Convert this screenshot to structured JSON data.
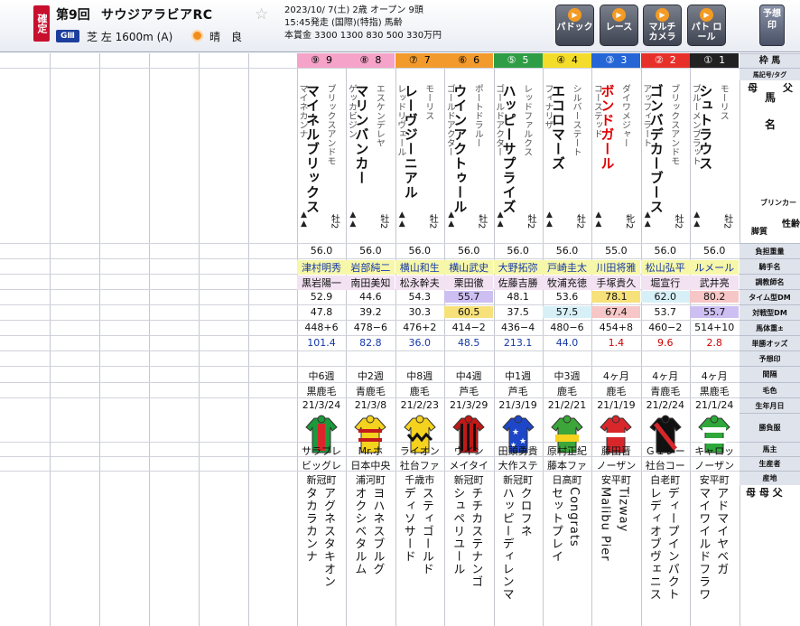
{
  "header": {
    "kakutei": "確定",
    "race_no": "第9回",
    "race_name": "サウジアラビアRC",
    "grade": "GⅢ",
    "course": "芝 左 1600m (A)",
    "weather": "晴",
    "track": "良",
    "info1": "2023/10/ 7(土) 2歳 オープン 9頭",
    "info2": "15:45発走 (国際)(特指) 馬齢",
    "info3": "本賞金 3300 1300 830 500 330万円",
    "buttons": [
      {
        "label": "パドック"
      },
      {
        "label": "レース"
      },
      {
        "label": "マルチ カメラ"
      },
      {
        "label": "パト ロール"
      }
    ],
    "yoso": "予想印"
  },
  "labels": {
    "waku_uma": "枠 馬",
    "kigo": "馬記号/タグ",
    "haha": "母",
    "uma": "馬",
    "chichi": "父",
    "mei": "名",
    "blinker": "ブリンカー",
    "kyakushitsu": "脚質",
    "seirei": "性齢",
    "futan": "負担重量",
    "kishu": "騎手名",
    "chokyo": "調教師名",
    "time_dm": "タイム型DM",
    "taisen_dm": "対戦型DM",
    "bataiju": "馬体重±",
    "odds": "単勝オッズ",
    "yosou": "予想印",
    "kankaku": "間隔",
    "keiro": "毛色",
    "seinen": "生年月日",
    "fuku": "勝負服",
    "banushi": "馬主",
    "seisansha": "生産者",
    "sanchi": "産地",
    "hahachichi": "母 母 父"
  },
  "horses": [
    {
      "waku": "①",
      "num": "1",
      "name": "シュトラウス",
      "sire": "モーリス",
      "dam": "ブルーメンブラット",
      "sex": "牡2",
      "weight": "56.0",
      "jockey": "ルメール",
      "trainer": "武井亮",
      "tdm": "80.2",
      "ddm": "55.7",
      "body": "514+10",
      "odds": "2.8",
      "interval": "4ヶ月",
      "coat": "黒鹿毛",
      "born": "21/1/24",
      "owner": "キャロッ",
      "breeder": "ノーザン",
      "region": "安平町",
      "damsire": "アドマイヤベガ",
      "damdam": "マイワイルドフラワ",
      "silk": "green"
    },
    {
      "waku": "②",
      "num": "2",
      "name": "ゴンバデカーブース",
      "sire": "ブリックスアンドモ",
      "dam": "アッフィラート",
      "sex": "牡2",
      "weight": "56.0",
      "jockey": "松山弘平",
      "trainer": "堀宣行",
      "tdm": "62.0",
      "ddm": "53.7",
      "body": "460−2",
      "odds": "9.6",
      "interval": "4ヶ月",
      "coat": "青鹿毛",
      "born": "21/2/24",
      "owner": "Ｇ１レー",
      "breeder": "社台コー",
      "region": "白老町",
      "damsire": "ディープインパクト",
      "damdam": "レディオブヴェニス",
      "silk": "black"
    },
    {
      "waku": "③",
      "num": "3",
      "name": "ボンドガール",
      "sire": "ダイワメジャー",
      "dam": "コーステッド",
      "sex": "牝2",
      "weight": "55.0",
      "jockey": "川田将雅",
      "trainer": "手塚貴久",
      "tdm": "78.1",
      "ddm": "67.4",
      "body": "454+8",
      "odds": "1.4",
      "interval": "4ヶ月",
      "coat": "鹿毛",
      "born": "21/1/19",
      "owner": "藤田晋",
      "breeder": "ノーザン",
      "region": "安平町",
      "damsire": "Tizway",
      "damdam": "Malibu Pier",
      "silk": "red"
    },
    {
      "waku": "④",
      "num": "4",
      "name": "エコロマーズ",
      "sire": "シルバーステート",
      "dam": "フィナリザ",
      "sex": "牡2",
      "weight": "56.0",
      "jockey": "戸崎圭太",
      "trainer": "牧浦充徳",
      "tdm": "53.6",
      "ddm": "57.5",
      "body": "480−6",
      "odds": "44.0",
      "interval": "中3週",
      "coat": "鹿毛",
      "born": "21/2/21",
      "owner": "原村正紀",
      "breeder": "藤本ファ",
      "region": "日高町",
      "damsire": "Congrats",
      "damdam": "セットプレイ",
      "silk": "lime"
    },
    {
      "waku": "⑤",
      "num": "5",
      "name": "ハッピーサプライズ",
      "sire": "レッドファルクス",
      "dam": "ゴールドアクター",
      "sex": "牡2",
      "weight": "56.0",
      "jockey": "大野拓弥",
      "trainer": "佐藤吉勝",
      "tdm": "48.1",
      "ddm": "37.5",
      "body": "436−4",
      "odds": "213.1",
      "interval": "中1週",
      "coat": "芦毛",
      "born": "21/3/19",
      "owner": "田頭勇貴",
      "breeder": "大作ステ",
      "region": "新冠町",
      "damsire": "クロフネ",
      "damdam": "ハッピーディレンマ",
      "silk": "blue"
    },
    {
      "waku": "⑥",
      "num": "6",
      "name": "ウインアクトゥール",
      "sire": "ポートドラルー",
      "dam": "ゴールドアクター",
      "sex": "牡2",
      "weight": "56.0",
      "jockey": "横山武史",
      "trainer": "栗田徹",
      "tdm": "55.7",
      "ddm": "60.5",
      "body": "414−2",
      "odds": "48.5",
      "interval": "中4週",
      "coat": "芦毛",
      "born": "21/3/29",
      "owner": "ウイン",
      "breeder": "メイタイ",
      "region": "新冠町",
      "damsire": "チチカステナンゴ",
      "damdam": "シュペリユール",
      "silk": "stripe"
    },
    {
      "waku": "⑦",
      "num": "7",
      "name": "レーヴジーニアル",
      "sire": "モーリス",
      "dam": "レッドリヴェール",
      "sex": "牡2",
      "weight": "56.0",
      "jockey": "横山和生",
      "trainer": "松永幹夫",
      "tdm": "54.3",
      "ddm": "30.3",
      "body": "476+2",
      "odds": "36.0",
      "interval": "中8週",
      "coat": "鹿毛",
      "born": "21/2/23",
      "owner": "ライオン",
      "breeder": "社台ファ",
      "region": "千歳市",
      "damsire": "スティゴールド",
      "damdam": "ディソサード",
      "silk": "zigzag"
    },
    {
      "waku": "⑧",
      "num": "8",
      "name": "マリンバンカー",
      "sire": "エスケンデレヤ",
      "dam": "ゲッカビジン",
      "sex": "牡2",
      "weight": "56.0",
      "jockey": "岩部純二",
      "trainer": "南田美知",
      "tdm": "44.6",
      "ddm": "39.2",
      "body": "478−6",
      "odds": "82.8",
      "interval": "中2週",
      "coat": "青鹿毛",
      "born": "21/3/8",
      "owner": "Mr.ホ",
      "breeder": "日本中央",
      "region": "浦河町",
      "damsire": "ヨハネスブルグ",
      "damdam": "オクシベタルム",
      "silk": "yellow"
    },
    {
      "waku": "⑨",
      "num": "9",
      "name": "マイネルブリックス",
      "sire": "ブリックスアンドモ",
      "dam": "マイネカンナ",
      "sex": "牡2",
      "weight": "56.0",
      "jockey": "津村明秀",
      "trainer": "黒岩陽一",
      "tdm": "52.9",
      "ddm": "47.8",
      "body": "448+6",
      "odds": "101.4",
      "interval": "中6週",
      "coat": "黒鹿毛",
      "born": "21/3/24",
      "owner": "サラブレ",
      "breeder": "ビッグレ",
      "region": "新冠町",
      "damsire": "アグネスタキオン",
      "damdam": "タカラカンナ",
      "silk": "greenred"
    }
  ]
}
